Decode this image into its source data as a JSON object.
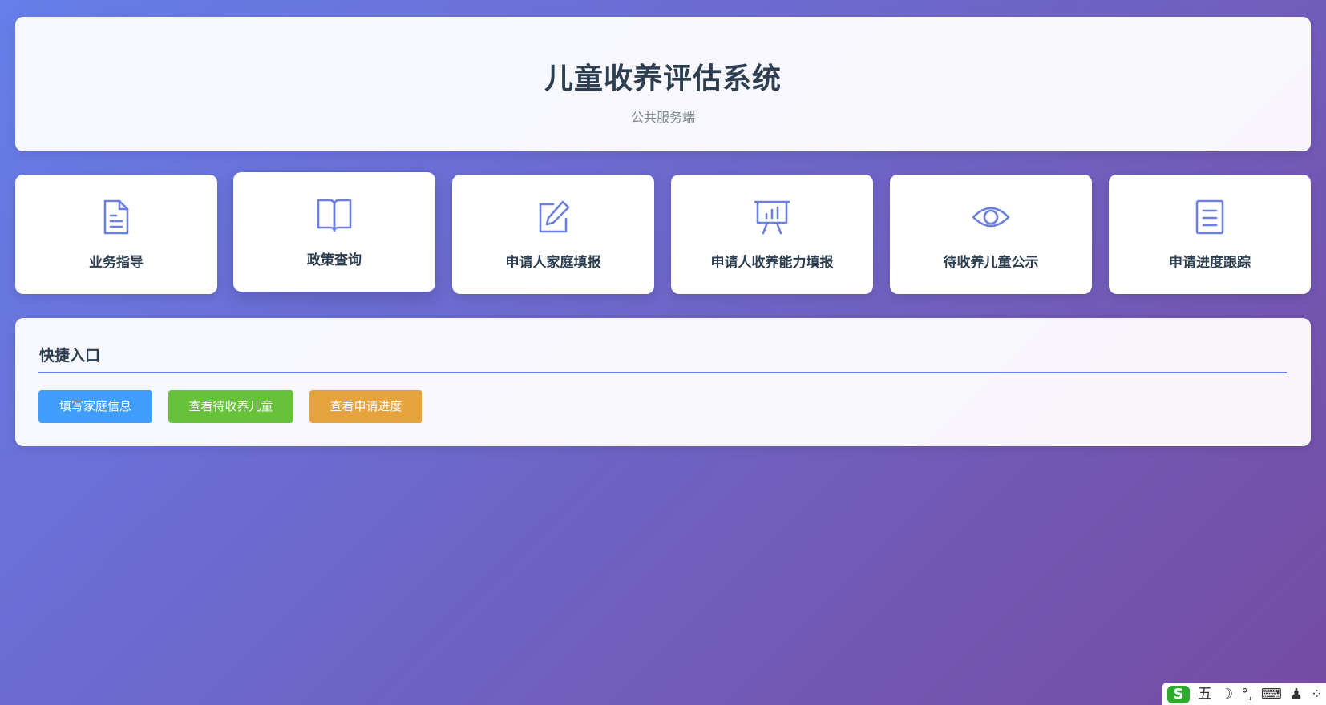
{
  "header": {
    "title": "儿童收养评估系统",
    "subtitle": "公共服务端"
  },
  "cards": [
    {
      "label": "业务指导",
      "icon": "document-icon"
    },
    {
      "label": "政策查询",
      "icon": "book-icon"
    },
    {
      "label": "申请人家庭填报",
      "icon": "edit-icon"
    },
    {
      "label": "申请人收养能力填报",
      "icon": "presentation-chart-icon"
    },
    {
      "label": "待收养儿童公示",
      "icon": "eye-icon"
    },
    {
      "label": "申请进度跟踪",
      "icon": "list-document-icon"
    }
  ],
  "quick": {
    "title": "快捷入口",
    "buttons": [
      {
        "label": "填写家庭信息",
        "color": "#409eff"
      },
      {
        "label": "查看待收养儿童",
        "color": "#67c23a"
      },
      {
        "label": "查看申请进度",
        "color": "#e6a23c"
      }
    ]
  },
  "ime": {
    "logo": "S",
    "mode": "五",
    "moon": "☽",
    "punct": "°,",
    "keyboard": "⌨",
    "user": "♟",
    "grid": "⁘"
  },
  "colors": {
    "accent": "#667eea",
    "bg_start": "#667eea",
    "bg_end": "#764ba2",
    "text": "#2c3e50"
  }
}
